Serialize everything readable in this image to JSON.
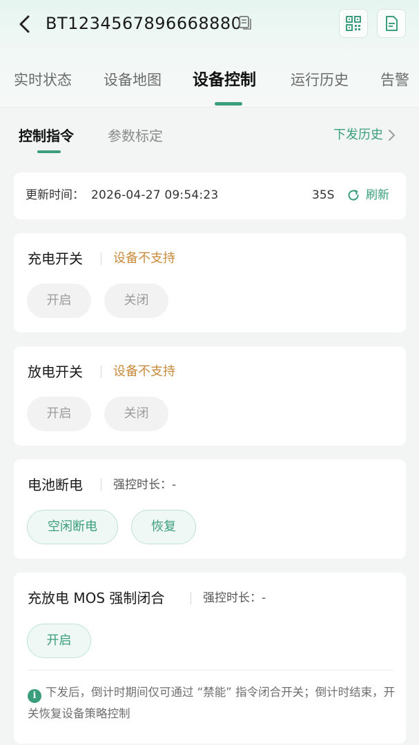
{
  "header": {
    "device_id": "BT1234567896668880",
    "icons": {
      "back": "chevron-left-icon",
      "copy": "copy-icon",
      "qrcode": "qrcode-icon",
      "document": "document-icon"
    }
  },
  "tabs": [
    {
      "label": "实时状态",
      "active": false
    },
    {
      "label": "设备地图",
      "active": false
    },
    {
      "label": "设备控制",
      "active": true
    },
    {
      "label": "运行历史",
      "active": false
    },
    {
      "label": "告警",
      "active": false
    }
  ],
  "subtabs": [
    {
      "label": "控制指令",
      "active": true
    },
    {
      "label": "参数标定",
      "active": false
    }
  ],
  "history_link": "下发历史",
  "update": {
    "label": "更新时间：",
    "time": "2026-04-27 09:54:23",
    "countdown": "35S",
    "refresh_label": "刷新"
  },
  "controls": [
    {
      "title": "充电开关",
      "status": "设备不支持",
      "buttons": [
        "开启",
        "关闭"
      ]
    },
    {
      "title": "放电开关",
      "status": "设备不支持",
      "buttons": [
        "开启",
        "关闭"
      ]
    },
    {
      "title": "电池断电",
      "duration_label": "强控时长：-",
      "buttons": [
        "空闲断电",
        "恢复"
      ]
    },
    {
      "title": "充放电 MOS 强制闭合",
      "duration_label": "强控时长：-",
      "buttons": [
        "开启"
      ],
      "note": "下发后，倒计时期间仅可通过 “禁能” 指令闭合开关；倒计时结束，开关恢复设备策略控制"
    }
  ],
  "colors": {
    "accent": "#3a9e7c",
    "warning": "#c98a3c",
    "disabled_bg": "#f2f2f2"
  }
}
